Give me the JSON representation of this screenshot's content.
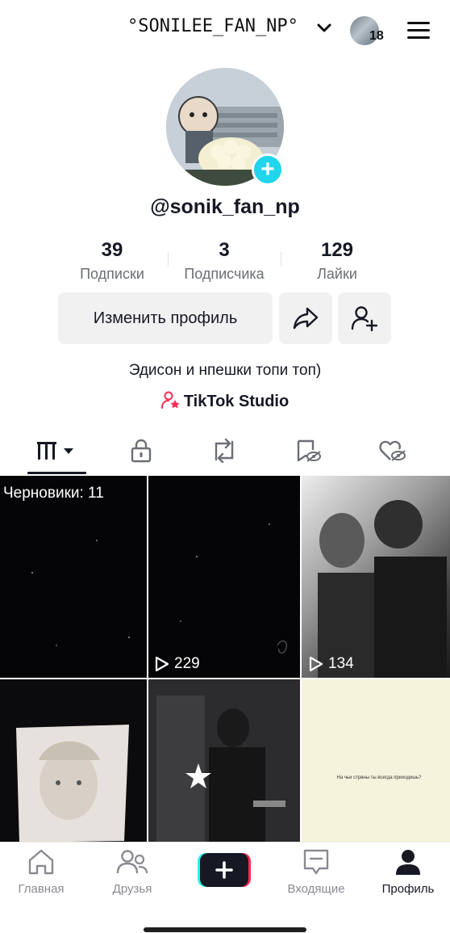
{
  "header": {
    "username": "°SONILEE_FAN_NP°",
    "notification_count": "18"
  },
  "profile": {
    "handle": "@sonik_fan_np",
    "stats": [
      {
        "value": "39",
        "label": "Подписки"
      },
      {
        "value": "3",
        "label": "Подписчика"
      },
      {
        "value": "129",
        "label": "Лайки"
      }
    ],
    "edit_label": "Изменить профиль",
    "bio": "Эдисон и нпешки топи топ)",
    "studio_label": "TikTok Studio"
  },
  "tabs": [
    "videos-tab",
    "private-tab",
    "reposts-tab",
    "favorites-tab",
    "liked-tab"
  ],
  "grid": {
    "drafts_label": "Черновики: 11",
    "items": [
      {
        "views": ""
      },
      {
        "views": "229"
      },
      {
        "views": "134"
      },
      {
        "views": ""
      },
      {
        "views": ""
      },
      {
        "views": ""
      }
    ],
    "caption_6": "На чьи стрвны ты всегда приходишь?"
  },
  "nav": {
    "home": "Главная",
    "friends": "Друзья",
    "inbox": "Входящие",
    "profile": "Профиль"
  },
  "colors": {
    "accent": "#20d5ec",
    "studio_icon": "#fe2c55",
    "text": "#161823",
    "muted": "#8a8b91"
  }
}
